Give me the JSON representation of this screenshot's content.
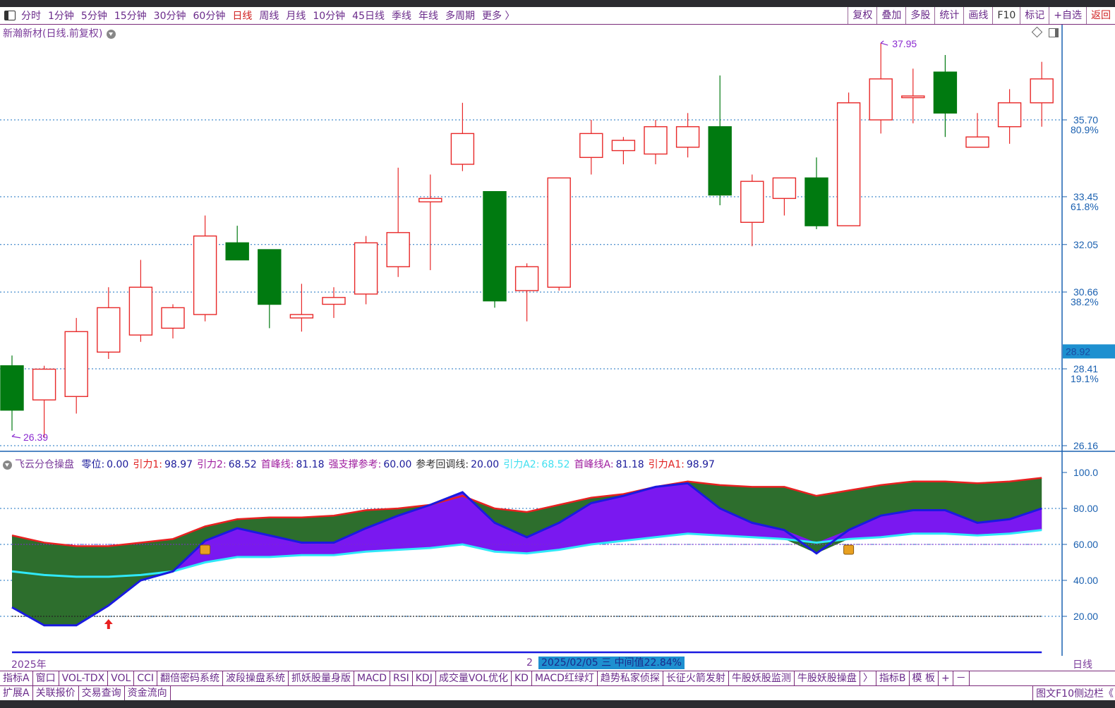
{
  "toolbar": {
    "periods": [
      "分时",
      "1分钟",
      "5分钟",
      "15分钟",
      "30分钟",
      "60分钟",
      "日线",
      "周线",
      "月线",
      "10分钟",
      "45日线",
      "季线",
      "年线",
      "多周期",
      "更多 〉"
    ],
    "active": "日线",
    "right_buttons": [
      "复权",
      "叠加",
      "多股",
      "统计",
      "画线",
      "F10",
      "标记",
      "+自选",
      "返回"
    ]
  },
  "chart": {
    "title": "新瀚新材(日线.前复权)",
    "price_labels": [
      "35.70",
      "33.45",
      "32.05",
      "30.66",
      "28.92",
      "28.41",
      "26.16"
    ],
    "fib_labels": [
      "80.9%",
      "61.8%",
      "38.2%",
      "19.1%"
    ],
    "high_label": "37.95",
    "low_label": "26.39",
    "current_price": "28.92",
    "candles": [
      {
        "o": 28.5,
        "h": 28.8,
        "l": 26.6,
        "c": 27.2
      },
      {
        "o": 27.5,
        "h": 28.5,
        "l": 26.39,
        "c": 28.4
      },
      {
        "o": 27.6,
        "h": 29.9,
        "l": 27.1,
        "c": 29.5
      },
      {
        "o": 28.9,
        "h": 30.8,
        "l": 28.7,
        "c": 30.2
      },
      {
        "o": 29.4,
        "h": 31.6,
        "l": 29.2,
        "c": 30.8
      },
      {
        "o": 29.6,
        "h": 30.3,
        "l": 29.3,
        "c": 30.2
      },
      {
        "o": 30.0,
        "h": 32.9,
        "l": 29.8,
        "c": 32.3
      },
      {
        "o": 32.1,
        "h": 32.6,
        "l": 31.7,
        "c": 31.6
      },
      {
        "o": 31.9,
        "h": 31.9,
        "l": 29.6,
        "c": 30.3
      },
      {
        "o": 29.9,
        "h": 30.9,
        "l": 29.5,
        "c": 30.0
      },
      {
        "o": 30.3,
        "h": 30.8,
        "l": 29.9,
        "c": 30.5
      },
      {
        "o": 30.6,
        "h": 32.3,
        "l": 30.3,
        "c": 32.1
      },
      {
        "o": 31.4,
        "h": 34.3,
        "l": 31.1,
        "c": 32.4
      },
      {
        "o": 33.3,
        "h": 34.1,
        "l": 31.3,
        "c": 33.4
      },
      {
        "o": 34.4,
        "h": 36.2,
        "l": 34.2,
        "c": 35.3
      },
      {
        "o": 33.6,
        "h": 33.6,
        "l": 30.2,
        "c": 30.4
      },
      {
        "o": 30.7,
        "h": 31.5,
        "l": 29.8,
        "c": 31.4
      },
      {
        "o": 30.8,
        "h": 34.0,
        "l": 30.7,
        "c": 34.0
      },
      {
        "o": 34.6,
        "h": 35.7,
        "l": 34.1,
        "c": 35.3
      },
      {
        "o": 34.8,
        "h": 35.2,
        "l": 34.4,
        "c": 35.1
      },
      {
        "o": 34.7,
        "h": 35.7,
        "l": 34.4,
        "c": 35.5
      },
      {
        "o": 34.9,
        "h": 35.9,
        "l": 34.6,
        "c": 35.5
      },
      {
        "o": 35.5,
        "h": 37.0,
        "l": 33.2,
        "c": 33.5
      },
      {
        "o": 32.7,
        "h": 34.1,
        "l": 32.0,
        "c": 33.9
      },
      {
        "o": 33.4,
        "h": 34.0,
        "l": 32.9,
        "c": 34.0
      },
      {
        "o": 34.0,
        "h": 34.6,
        "l": 32.5,
        "c": 32.6
      },
      {
        "o": 32.6,
        "h": 36.5,
        "l": 32.6,
        "c": 36.2
      },
      {
        "o": 35.7,
        "h": 37.95,
        "l": 35.3,
        "c": 36.9
      },
      {
        "o": 36.35,
        "h": 37.2,
        "l": 35.6,
        "c": 36.4
      },
      {
        "o": 37.1,
        "h": 37.6,
        "l": 35.2,
        "c": 35.9
      },
      {
        "o": 34.9,
        "h": 35.9,
        "l": 34.9,
        "c": 35.2
      },
      {
        "o": 35.5,
        "h": 36.6,
        "l": 35.0,
        "c": 36.2
      },
      {
        "o": 36.2,
        "h": 37.4,
        "l": 35.5,
        "c": 36.9
      }
    ]
  },
  "indicator": {
    "name": "飞云分仓操盘",
    "params": [
      {
        "label": "零位:",
        "value": "0.00",
        "color": "#1a1a9a"
      },
      {
        "label": "引力1:",
        "value": "98.97",
        "color": "#e02020"
      },
      {
        "label": "引力2:",
        "value": "68.52",
        "color": "#a020a0"
      },
      {
        "label": "首峰线:",
        "value": "81.18",
        "color": "#a020a0"
      },
      {
        "label": "强支撑参考:",
        "value": "60.00",
        "color": "#a020a0"
      },
      {
        "label": "参考回调线:",
        "value": "20.00",
        "color": "#333333"
      },
      {
        "label": "引力A2:",
        "value": "68.52",
        "color": "#40e0f0"
      },
      {
        "label": "首峰线A:",
        "value": "81.18",
        "color": "#a020a0"
      },
      {
        "label": "引力A1:",
        "value": "98.97",
        "color": "#e02020"
      }
    ],
    "axis_labels": [
      "100.0",
      "80.00",
      "60.00",
      "40.00",
      "20.00"
    ],
    "ylim": [
      0,
      100
    ],
    "red": [
      65,
      61,
      59,
      59,
      61,
      63,
      70,
      74,
      75,
      75,
      76,
      79,
      80,
      82,
      87,
      80,
      78,
      82,
      86,
      88,
      92,
      95,
      93,
      92,
      92,
      87,
      90,
      93,
      95,
      95,
      94,
      95,
      97
    ],
    "blue": [
      25,
      15,
      15,
      26,
      40,
      45,
      62,
      69,
      65,
      61,
      61,
      69,
      76,
      82,
      89,
      72,
      64,
      72,
      83,
      87,
      92,
      94,
      80,
      72,
      68,
      55,
      68,
      76,
      79,
      79,
      72,
      74,
      80
    ],
    "cyan": [
      45,
      43,
      42,
      42,
      43,
      45,
      50,
      53,
      53,
      54,
      54,
      56,
      57,
      58,
      60,
      56,
      55,
      57,
      60,
      62,
      64,
      66,
      65,
      64,
      63,
      61,
      63,
      64,
      66,
      66,
      65,
      66,
      68
    ],
    "up_arrow_index": 3
  },
  "date_bar": {
    "year": "2025年",
    "cursor_index": "2",
    "selected_info": "2025/02/05 三 中间值22.84%",
    "right_label": "日线"
  },
  "tabs_row1": [
    "指标A",
    "窗口",
    "VOL-TDX",
    "VOL",
    "CCI",
    "翻倍密码系统",
    "波段操盘系统",
    "抓妖股量身版",
    "MACD",
    "RSI",
    "KDJ",
    "成交量VOL优化",
    "KD",
    "MACD红绿灯",
    "趋势私家侦探",
    "长征火箭发射",
    "牛股妖股监测",
    "牛股妖股操盘",
    "〉",
    "指标B",
    "模 板",
    "+",
    "－"
  ],
  "tabs_row2": [
    "扩展A",
    "关联报价",
    "交易查询",
    "资金流向"
  ],
  "tabs_row2_right": "图文F10侧边栏《",
  "colors": {
    "up": "#e82828",
    "down": "#007a10",
    "axis": "#1a60b0",
    "purple_text": "#7a3a9a",
    "fill_green": "#2d6e2d",
    "fill_purple": "#7a18f0"
  }
}
